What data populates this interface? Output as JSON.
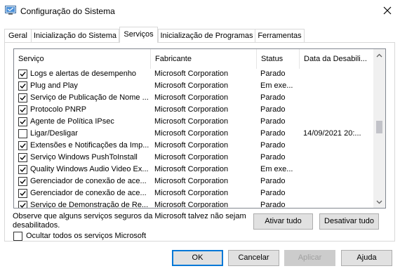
{
  "window": {
    "title": "Configuração do Sistema",
    "icon": "system-config-icon",
    "close_glyph": "✕"
  },
  "tabs": [
    {
      "label": "Geral",
      "active": false
    },
    {
      "label": "Inicialização do Sistema",
      "active": false
    },
    {
      "label": "Serviços",
      "active": true
    },
    {
      "label": "Inicialização de Programas",
      "active": false
    },
    {
      "label": "Ferramentas",
      "active": false
    }
  ],
  "services": {
    "columns": [
      "Serviço",
      "Fabricante",
      "Status",
      "Data da Desabili..."
    ],
    "rows": [
      {
        "checked": true,
        "name": "Logs e alertas de desempenho",
        "manufacturer": "Microsoft Corporation",
        "status": "Parado",
        "date": ""
      },
      {
        "checked": true,
        "name": "Plug and Play",
        "manufacturer": "Microsoft Corporation",
        "status": "Em exe...",
        "date": ""
      },
      {
        "checked": true,
        "name": "Serviço de Publicação de Nome ...",
        "manufacturer": "Microsoft Corporation",
        "status": "Parado",
        "date": ""
      },
      {
        "checked": true,
        "name": "Protocolo PNRP",
        "manufacturer": "Microsoft Corporation",
        "status": "Parado",
        "date": ""
      },
      {
        "checked": true,
        "name": "Agente de Política IPsec",
        "manufacturer": "Microsoft Corporation",
        "status": "Parado",
        "date": ""
      },
      {
        "checked": false,
        "name": "Ligar/Desligar",
        "manufacturer": "Microsoft Corporation",
        "status": "Parado",
        "date": "14/09/2021 20:..."
      },
      {
        "checked": true,
        "name": "Extensões e Notificações da Imp...",
        "manufacturer": "Microsoft Corporation",
        "status": "Parado",
        "date": ""
      },
      {
        "checked": true,
        "name": "Serviço Windows PushToInstall",
        "manufacturer": "Microsoft Corporation",
        "status": "Parado",
        "date": ""
      },
      {
        "checked": true,
        "name": "Quality Windows Audio Video Ex...",
        "manufacturer": "Microsoft Corporation",
        "status": "Em exe...",
        "date": ""
      },
      {
        "checked": true,
        "name": "Gerenciador de conexão de ace...",
        "manufacturer": "Microsoft Corporation",
        "status": "Parado",
        "date": ""
      },
      {
        "checked": true,
        "name": "Gerenciador de conexão de ace...",
        "manufacturer": "Microsoft Corporation",
        "status": "Parado",
        "date": ""
      },
      {
        "checked": true,
        "name": "Serviço de Demonstração de Re...",
        "manufacturer": "Microsoft Corporation",
        "status": "Parado",
        "date": ""
      }
    ]
  },
  "note": "Observe que alguns serviços seguros da Microsoft talvez não sejam desabilitados.",
  "actions": {
    "enable_all": "Ativar tudo",
    "disable_all": "Desativar tudo"
  },
  "hide_ms": {
    "label": "Ocultar todos os serviços Microsoft",
    "checked": false
  },
  "dialog_buttons": {
    "ok": "OK",
    "cancel": "Cancelar",
    "apply": "Aplicar",
    "help": "Ajuda"
  },
  "colors": {
    "accent": "#0078d7",
    "border": "#d9d9d9",
    "button_face": "#e1e1e1"
  }
}
